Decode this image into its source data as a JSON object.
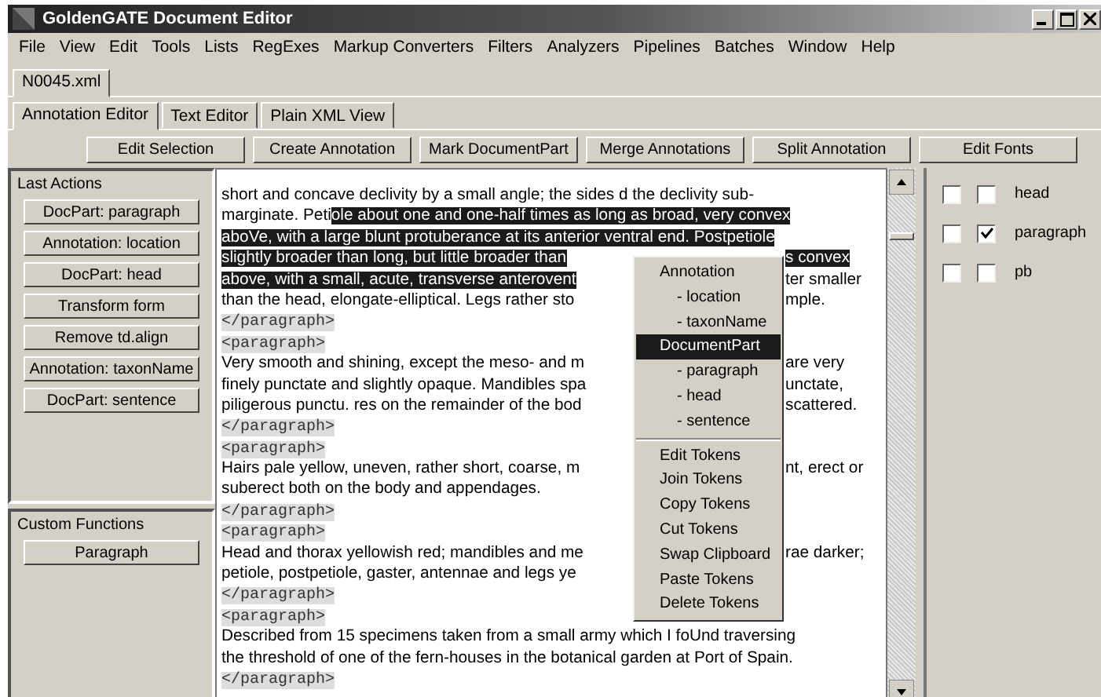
{
  "window": {
    "title": "GoldenGATE Document Editor"
  },
  "menu_bar": [
    "File",
    "View",
    "Edit",
    "Tools",
    "Lists",
    "RegExes",
    "Markup Converters",
    "Filters",
    "Analyzers",
    "Pipelines",
    "Batches",
    "Window",
    "Help"
  ],
  "document_tabs": [
    {
      "label": "N0045.xml",
      "selected": true
    }
  ],
  "editor_tabs": [
    {
      "label": "Annotation Editor",
      "selected": true
    },
    {
      "label": "Text Editor",
      "selected": false
    },
    {
      "label": "Plain XML View",
      "selected": false
    }
  ],
  "toolbar": [
    "Edit Selection",
    "Create Annotation",
    "Mark DocumentPart",
    "Merge Annotations",
    "Split Annotation",
    "Edit Fonts"
  ],
  "last_actions": {
    "title": "Last Actions",
    "buttons": [
      "DocPart: paragraph",
      "Annotation: location",
      "DocPart: head",
      "Transform form",
      "Remove td.align",
      "Annotation: taxonName",
      "DocPart: sentence"
    ]
  },
  "custom_functions": {
    "title": "Custom Functions",
    "buttons": [
      "Paragraph"
    ]
  },
  "editor_lines": [
    {
      "kind": "text",
      "parts": [
        {
          "text": "short and concave declivity by a small angle; the sides d the declivity sub-",
          "selected": false
        }
      ]
    },
    {
      "kind": "text",
      "parts": [
        {
          "text": "marginate. Peti",
          "selected": false
        },
        {
          "text": "ole about one and one-half times as long as broad, very convex",
          "selected": true
        }
      ]
    },
    {
      "kind": "text",
      "parts": [
        {
          "text": "aboVe, with a large blunt protuberance at its anterior ventral end. Postpetiole",
          "selected": true
        }
      ]
    },
    {
      "kind": "split",
      "parts": [
        {
          "text": "slightly broader than long, but little broader than",
          "selected": true
        }
      ],
      "after": [
        {
          "text": "s convex",
          "selected": true
        }
      ]
    },
    {
      "kind": "split",
      "parts": [
        {
          "text": "above, with a small, acute, transverse anterovent",
          "selected": true
        }
      ],
      "after": [
        {
          "text": "ter smaller",
          "selected": false
        }
      ]
    },
    {
      "kind": "split",
      "parts": [
        {
          "text": "than the head, elongate-elliptical. Legs rather sto",
          "selected": false
        }
      ],
      "after": [
        {
          "text": "mple.",
          "selected": false
        }
      ]
    },
    {
      "kind": "tag",
      "parts": [
        {
          "text": "</paragraph>",
          "selected": false
        }
      ]
    },
    {
      "kind": "tag",
      "parts": [
        {
          "text": "<paragraph>",
          "selected": false
        }
      ]
    },
    {
      "kind": "split",
      "parts": [
        {
          "text": "Very smooth and shining, except the meso- and m",
          "selected": false
        }
      ],
      "after": [
        {
          "text": "are very",
          "selected": false
        }
      ]
    },
    {
      "kind": "split",
      "parts": [
        {
          "text": "finely punctate and slightly opaque. Mandibles spa",
          "selected": false
        }
      ],
      "after": [
        {
          "text": "unctate,",
          "selected": false
        }
      ]
    },
    {
      "kind": "split",
      "parts": [
        {
          "text": "piligerous punctu. res on the remainder of the bod",
          "selected": false
        }
      ],
      "after": [
        {
          "text": "scattered.",
          "selected": false
        }
      ]
    },
    {
      "kind": "tag",
      "parts": [
        {
          "text": "</paragraph>",
          "selected": false
        }
      ]
    },
    {
      "kind": "tag",
      "parts": [
        {
          "text": "<paragraph>",
          "selected": false
        }
      ]
    },
    {
      "kind": "split",
      "parts": [
        {
          "text": "Hairs pale yellow, uneven, rather short, coarse, m",
          "selected": false
        }
      ],
      "after": [
        {
          "text": "nt, erect or",
          "selected": false
        }
      ]
    },
    {
      "kind": "text",
      "parts": [
        {
          "text": "suberect both on the body and appendages.",
          "selected": false
        }
      ]
    },
    {
      "kind": "tag",
      "parts": [
        {
          "text": "</paragraph>",
          "selected": false
        }
      ]
    },
    {
      "kind": "tag",
      "parts": [
        {
          "text": "<paragraph>",
          "selected": false
        }
      ]
    },
    {
      "kind": "split",
      "parts": [
        {
          "text": "Head and thorax yellowish red; mandibles and me",
          "selected": false
        }
      ],
      "after": [
        {
          "text": "rae darker;",
          "selected": false
        }
      ]
    },
    {
      "kind": "split",
      "parts": [
        {
          "text": "petiole, postpetiole, gaster, antennae and legs ye",
          "selected": false
        }
      ]
    },
    {
      "kind": "tag",
      "parts": [
        {
          "text": "</paragraph>",
          "selected": false
        }
      ]
    },
    {
      "kind": "tag",
      "parts": [
        {
          "text": "<paragraph>",
          "selected": false
        }
      ]
    },
    {
      "kind": "text",
      "parts": [
        {
          "text": "Described from 15 specimens taken from a small army which I foUnd traversing",
          "selected": false
        }
      ]
    },
    {
      "kind": "text",
      "parts": [
        {
          "text": "the threshold of one of the fern-houses in the botanical garden at Port of Spain.",
          "selected": false
        }
      ]
    },
    {
      "kind": "tag",
      "parts": [
        {
          "text": "</paragraph>",
          "selected": false
        }
      ]
    }
  ],
  "context_menu": {
    "groups": [
      [
        {
          "label": "Annotation",
          "selected": false,
          "children": [
            {
              "label": "- location",
              "selected": false
            },
            {
              "label": "- taxonName",
              "selected": false
            }
          ]
        },
        {
          "label": "DocumentPart",
          "selected": true,
          "children": [
            {
              "label": "- paragraph",
              "selected": false
            },
            {
              "label": "- head",
              "selected": false
            },
            {
              "label": "- sentence",
              "selected": false
            }
          ]
        }
      ],
      [
        {
          "label": "Edit Tokens",
          "selected": false
        },
        {
          "label": "Join Tokens",
          "selected": false
        },
        {
          "label": "Copy Tokens",
          "selected": false
        },
        {
          "label": "Cut Tokens",
          "selected": false
        },
        {
          "label": "Swap Clipboard",
          "selected": false
        },
        {
          "label": "Paste Tokens",
          "selected": false
        },
        {
          "label": "Delete Tokens",
          "selected": false
        }
      ]
    ]
  },
  "annotation_types": [
    {
      "label": "head",
      "checks": [
        false,
        false
      ]
    },
    {
      "label": "paragraph",
      "checks": [
        false,
        true
      ]
    },
    {
      "label": "pb",
      "checks": [
        false,
        false
      ]
    }
  ]
}
